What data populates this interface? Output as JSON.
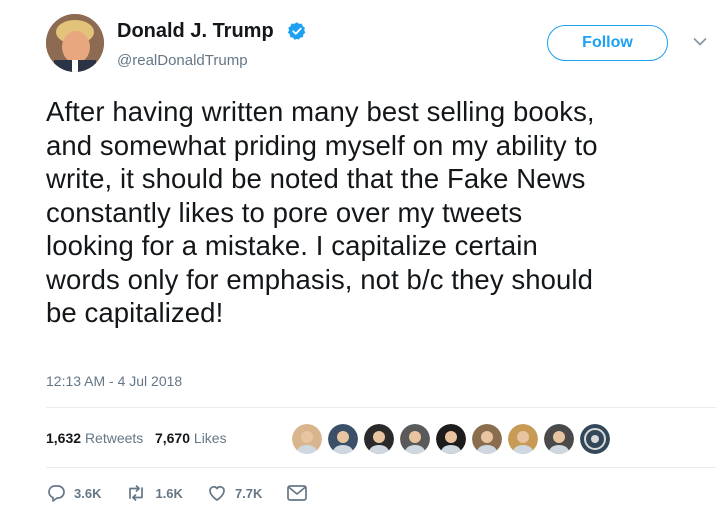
{
  "author": {
    "name": "Donald J. Trump",
    "handle": "@realDonaldTrump",
    "verified": true
  },
  "follow_label": "Follow",
  "tweet": {
    "text": "After having written many best selling books,\nand somewhat priding myself on my ability to\nwrite, it should be noted that the Fake News\nconstantly likes to pore over my tweets\nlooking for a mistake. I capitalize certain\nwords only for emphasis, not b/c they should\nbe capitalized!",
    "timestamp": "12:13 AM - 4 Jul 2018"
  },
  "stats": {
    "retweets_count": "1,632",
    "retweets_label": "Retweets",
    "likes_count": "7,670",
    "likes_label": "Likes"
  },
  "likers": [
    {
      "icon": "person-avatar",
      "color": "#d8b58c"
    },
    {
      "icon": "person-avatar",
      "color": "#3b5068"
    },
    {
      "icon": "person-avatar",
      "color": "#2a2a2a"
    },
    {
      "icon": "person-avatar",
      "color": "#5a5a5a"
    },
    {
      "icon": "person-avatar",
      "color": "#1c1c1c"
    },
    {
      "icon": "person-avatar",
      "color": "#8a6d4d"
    },
    {
      "icon": "person-avatar",
      "color": "#c79a55"
    },
    {
      "icon": "person-avatar",
      "color": "#4a4a4a"
    },
    {
      "icon": "seal-avatar",
      "color": "#33475b"
    }
  ],
  "actions": {
    "reply_count": "3.6K",
    "retweet_count": "1.6K",
    "like_count": "7.7K"
  },
  "colors": {
    "accent": "#1da1f2",
    "muted": "#657786",
    "text": "#14171a",
    "divider": "#e6ecf0"
  }
}
